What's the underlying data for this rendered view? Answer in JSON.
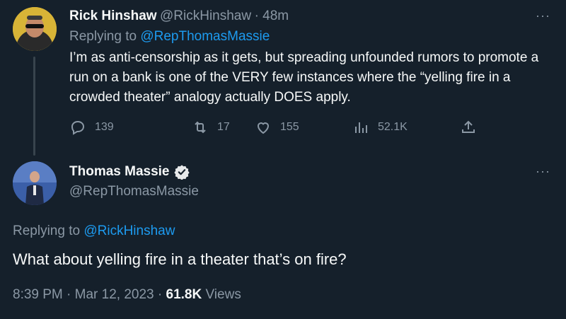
{
  "tweet1": {
    "name": "Rick Hinshaw",
    "handle": "@RickHinshaw",
    "time": "· 48m",
    "replying_prefix": "Replying to ",
    "replying_handle": "@RepThomasMassie",
    "text": "I’m as anti-censorship as it gets, but spreading unfounded rumors to promote a run on a bank is one of the VERY few instances where the “yelling fire in a crowded theater” analogy actually DOES apply.",
    "replies": "139",
    "retweets": "17",
    "likes": "155",
    "views": "52.1K",
    "more": "···"
  },
  "tweet2": {
    "name": "Thomas Massie",
    "handle": "@RepThomasMassie",
    "replying_prefix": "Replying to ",
    "replying_handle": "@RickHinshaw",
    "text": "What about yelling fire in a theater that’s on fire?",
    "timestamp": "8:39 PM · Mar 12, 2023 · ",
    "views_count": "61.8K",
    "views_label": " Views",
    "more": "···"
  },
  "icons": {
    "reply": "reply-icon",
    "retweet": "retweet-icon",
    "like": "like-icon",
    "views": "views-icon",
    "share": "share-icon",
    "verified": "verified-badge-icon"
  },
  "colors": {
    "background": "#15202b",
    "text": "#f7f9f9",
    "secondary": "#8b98a5",
    "link": "#1d9bf0"
  }
}
